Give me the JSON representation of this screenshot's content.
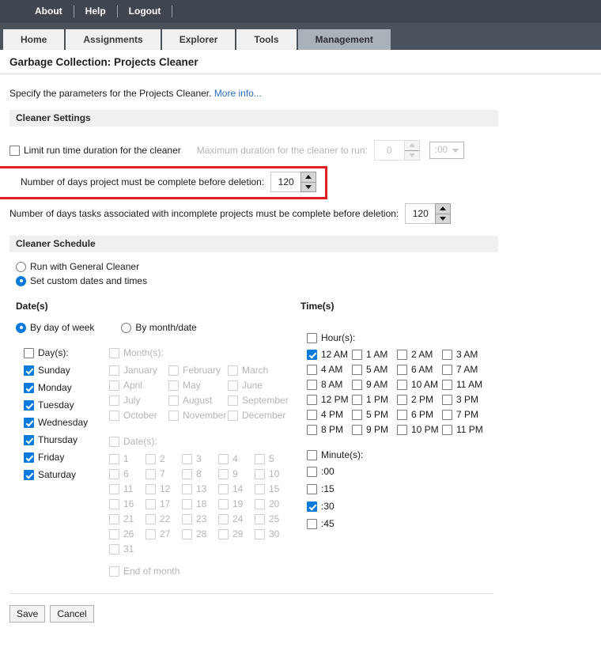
{
  "topbar": {
    "links": [
      "About",
      "Help",
      "Logout"
    ]
  },
  "tabs": [
    {
      "label": "Home",
      "active": false
    },
    {
      "label": "Assignments",
      "active": false
    },
    {
      "label": "Explorer",
      "active": false
    },
    {
      "label": "Tools",
      "active": false
    },
    {
      "label": "Management",
      "active": true
    }
  ],
  "page": {
    "title": "Garbage Collection: Projects Cleaner",
    "intro_text": "Specify the parameters for the Projects Cleaner.",
    "intro_link": "More info..."
  },
  "cleaner_settings": {
    "header": "Cleaner Settings",
    "limit_run_time": {
      "label": "Limit run time duration for the cleaner",
      "checked": false
    },
    "max_duration": {
      "label": "Maximum duration for the cleaner to run:",
      "value": "0",
      "select_value": ":00",
      "disabled": true
    },
    "days_project_complete": {
      "label": "Number of days project must be complete before deletion:",
      "value": "120",
      "highlighted": true
    },
    "days_tasks_complete": {
      "label": "Number of days tasks associated with incomplete projects must be complete before deletion:",
      "value": "120"
    }
  },
  "cleaner_schedule": {
    "header": "Cleaner Schedule",
    "mode_options": [
      {
        "label": "Run with General Cleaner",
        "selected": false
      },
      {
        "label": "Set custom dates and times",
        "selected": true
      }
    ],
    "dates": {
      "heading": "Date(s)",
      "mode_options": [
        {
          "label": "By day of week",
          "selected": true
        },
        {
          "label": "By month/date",
          "selected": false
        }
      ],
      "days_group_label": "Day(s):",
      "days_group_checked": false,
      "days": [
        {
          "label": "Sunday",
          "checked": true
        },
        {
          "label": "Monday",
          "checked": true
        },
        {
          "label": "Tuesday",
          "checked": true
        },
        {
          "label": "Wednesday",
          "checked": true
        },
        {
          "label": "Thursday",
          "checked": true
        },
        {
          "label": "Friday",
          "checked": true
        },
        {
          "label": "Saturday",
          "checked": true
        }
      ],
      "months_group_label": "Month(s):",
      "months_group_checked": false,
      "months_disabled": true,
      "months": [
        {
          "label": "January",
          "checked": false
        },
        {
          "label": "February",
          "checked": false
        },
        {
          "label": "March",
          "checked": false
        },
        {
          "label": "April",
          "checked": false
        },
        {
          "label": "May",
          "checked": false
        },
        {
          "label": "June",
          "checked": false
        },
        {
          "label": "July",
          "checked": false
        },
        {
          "label": "August",
          "checked": false
        },
        {
          "label": "September",
          "checked": false
        },
        {
          "label": "October",
          "checked": false
        },
        {
          "label": "November",
          "checked": false
        },
        {
          "label": "December",
          "checked": false
        }
      ],
      "dates_group_label": "Date(s):",
      "dates_group_checked": false,
      "dates_disabled": true,
      "date_numbers": [
        "1",
        "2",
        "3",
        "4",
        "5",
        "6",
        "7",
        "8",
        "9",
        "10",
        "11",
        "12",
        "13",
        "14",
        "15",
        "16",
        "17",
        "18",
        "19",
        "20",
        "21",
        "22",
        "23",
        "24",
        "25",
        "26",
        "27",
        "28",
        "29",
        "30",
        "31"
      ],
      "end_of_month_label": "End of month",
      "end_of_month_checked": false
    },
    "times": {
      "heading": "Time(s)",
      "hours_group_label": "Hour(s):",
      "hours_group_checked": false,
      "hours": [
        {
          "label": "12 AM",
          "checked": true
        },
        {
          "label": "1 AM",
          "checked": false
        },
        {
          "label": "2 AM",
          "checked": false
        },
        {
          "label": "3 AM",
          "checked": false
        },
        {
          "label": "4 AM",
          "checked": false
        },
        {
          "label": "5 AM",
          "checked": false
        },
        {
          "label": "6 AM",
          "checked": false
        },
        {
          "label": "7 AM",
          "checked": false
        },
        {
          "label": "8 AM",
          "checked": false
        },
        {
          "label": "9 AM",
          "checked": false
        },
        {
          "label": "10 AM",
          "checked": false
        },
        {
          "label": "11 AM",
          "checked": false
        },
        {
          "label": "12 PM",
          "checked": false
        },
        {
          "label": "1 PM",
          "checked": false
        },
        {
          "label": "2 PM",
          "checked": false
        },
        {
          "label": "3 PM",
          "checked": false
        },
        {
          "label": "4 PM",
          "checked": false
        },
        {
          "label": "5 PM",
          "checked": false
        },
        {
          "label": "6 PM",
          "checked": false
        },
        {
          "label": "7 PM",
          "checked": false
        },
        {
          "label": "8 PM",
          "checked": false
        },
        {
          "label": "9 PM",
          "checked": false
        },
        {
          "label": "10 PM",
          "checked": false
        },
        {
          "label": "11 PM",
          "checked": false
        }
      ],
      "minutes_group_label": "Minute(s):",
      "minutes_group_checked": false,
      "minutes": [
        {
          "label": ":00",
          "checked": false
        },
        {
          "label": ":15",
          "checked": false
        },
        {
          "label": ":30",
          "checked": true
        },
        {
          "label": ":45",
          "checked": false
        }
      ]
    }
  },
  "footer": {
    "save_label": "Save",
    "cancel_label": "Cancel"
  },
  "colors": {
    "topbar_bg": "#3f4650",
    "tabbar_bg": "#4a525c",
    "tab_active_bg": "#a9b1b9",
    "section_header_bg": "#f0f0f0",
    "accent_checkbox": "#0a7bdc",
    "highlight_border": "#e02020",
    "link": "#2a6ebb"
  }
}
